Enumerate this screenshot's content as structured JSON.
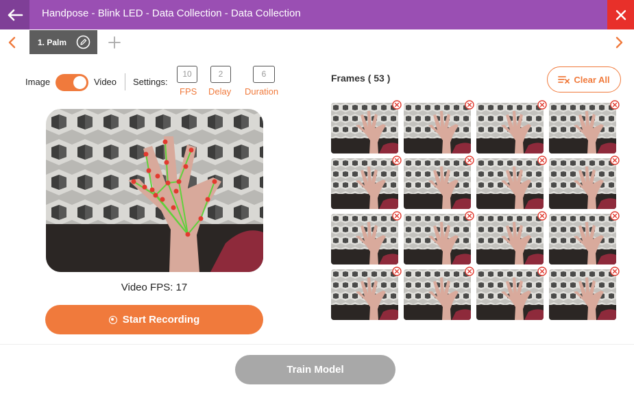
{
  "app": {
    "title": "Handpose - Blink LED - Data Collection - Data Collection",
    "accent_color": "#9a4fb3",
    "primary_color": "#f07a3c"
  },
  "tabs": [
    {
      "label": "1. Palm",
      "active": true
    }
  ],
  "settings": {
    "image_label": "Image",
    "video_label": "Video",
    "mode": "Video",
    "settings_label": "Settings:",
    "fps": {
      "value": "10",
      "label": "FPS"
    },
    "delay": {
      "value": "2",
      "label": "Delay"
    },
    "duration": {
      "value": "6",
      "label": "Duration"
    }
  },
  "camera": {
    "fps_text": "Video FPS: 17",
    "record_label": "Start Recording"
  },
  "frames": {
    "title": "Frames ( 53 )",
    "clear_label": "Clear All",
    "visible_count": 16
  },
  "footer": {
    "train_label": "Train Model"
  }
}
